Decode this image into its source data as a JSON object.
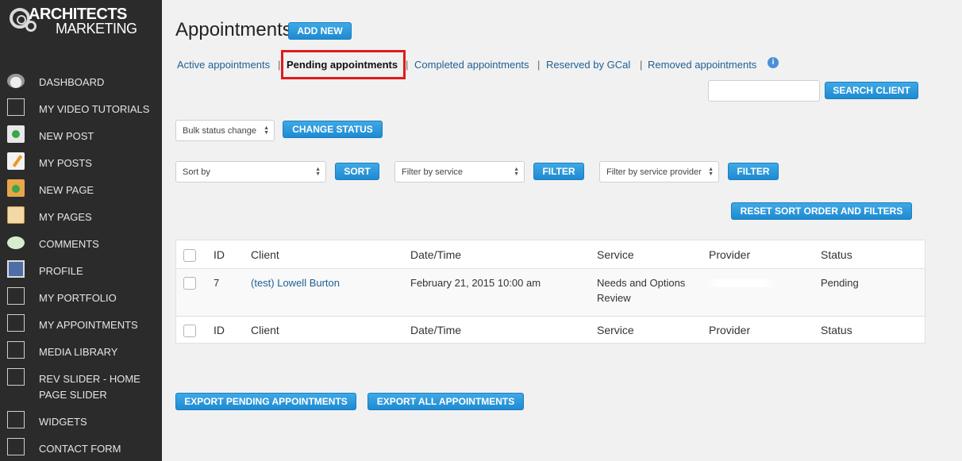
{
  "logo": {
    "line1": "ARCHITECTS",
    "line2": "MARKETING"
  },
  "sidebar": {
    "items": [
      {
        "label": "DASHBOARD",
        "icon": "dashboard-icon"
      },
      {
        "label": "MY VIDEO TUTORIALS",
        "icon": "placeholder-box-icon"
      },
      {
        "label": "NEW POST",
        "icon": "new-post-icon"
      },
      {
        "label": "MY POSTS",
        "icon": "my-posts-icon"
      },
      {
        "label": "NEW PAGE",
        "icon": "new-page-icon"
      },
      {
        "label": "MY PAGES",
        "icon": "my-pages-icon"
      },
      {
        "label": "COMMENTS",
        "icon": "comments-icon"
      },
      {
        "label": "PROFILE",
        "icon": "profile-icon"
      },
      {
        "label": "MY PORTFOLIO",
        "icon": "placeholder-box-icon"
      },
      {
        "label": "MY APPOINTMENTS",
        "icon": "placeholder-box-icon"
      },
      {
        "label": "MEDIA LIBRARY",
        "icon": "placeholder-box-icon"
      },
      {
        "label": "REV SLIDER - HOME PAGE SLIDER",
        "icon": "placeholder-box-icon"
      },
      {
        "label": "WIDGETS",
        "icon": "placeholder-box-icon"
      },
      {
        "label": "CONTACT FORM",
        "icon": "placeholder-box-icon"
      }
    ]
  },
  "header": {
    "title": "Appointments",
    "add_new": "ADD NEW"
  },
  "tabs": {
    "active_appointments": "Active appointments",
    "pending_appointments": "Pending appointments",
    "completed_appointments": "Completed appointments",
    "reserved_by_gcal": "Reserved by GCal",
    "removed_appointments": "Removed appointments",
    "separator": "|",
    "info_icon": "i"
  },
  "search": {
    "value": "",
    "button": "SEARCH CLIENT"
  },
  "bulk": {
    "select_value": "Bulk status change",
    "button": "CHANGE STATUS"
  },
  "filters": {
    "sort_by": "Sort by",
    "sort_button": "SORT",
    "filter_service": "Filter by service",
    "filter_service_button": "FILTER",
    "filter_provider": "Filter by service provider",
    "filter_provider_button": "FILTER",
    "reset_button": "RESET SORT ORDER AND FILTERS"
  },
  "table": {
    "columns": [
      "ID",
      "Client",
      "Date/Time",
      "Service",
      "Provider",
      "Status"
    ],
    "rows": [
      {
        "id": "7",
        "client": "(test) Lowell Burton",
        "datetime": "February 21, 2015 10:00 am",
        "service_line1": "Needs and Options",
        "service_line2": "Review",
        "provider": "",
        "status": "Pending"
      }
    ]
  },
  "export": {
    "pending": "EXPORT PENDING APPOINTMENTS",
    "all": "EXPORT ALL APPOINTMENTS"
  },
  "colors": {
    "sidebar_bg": "#2b2b2b",
    "button_blue": "#1e8ad2",
    "link_blue": "#1f5f95",
    "highlight_red": "#e01b1b"
  }
}
